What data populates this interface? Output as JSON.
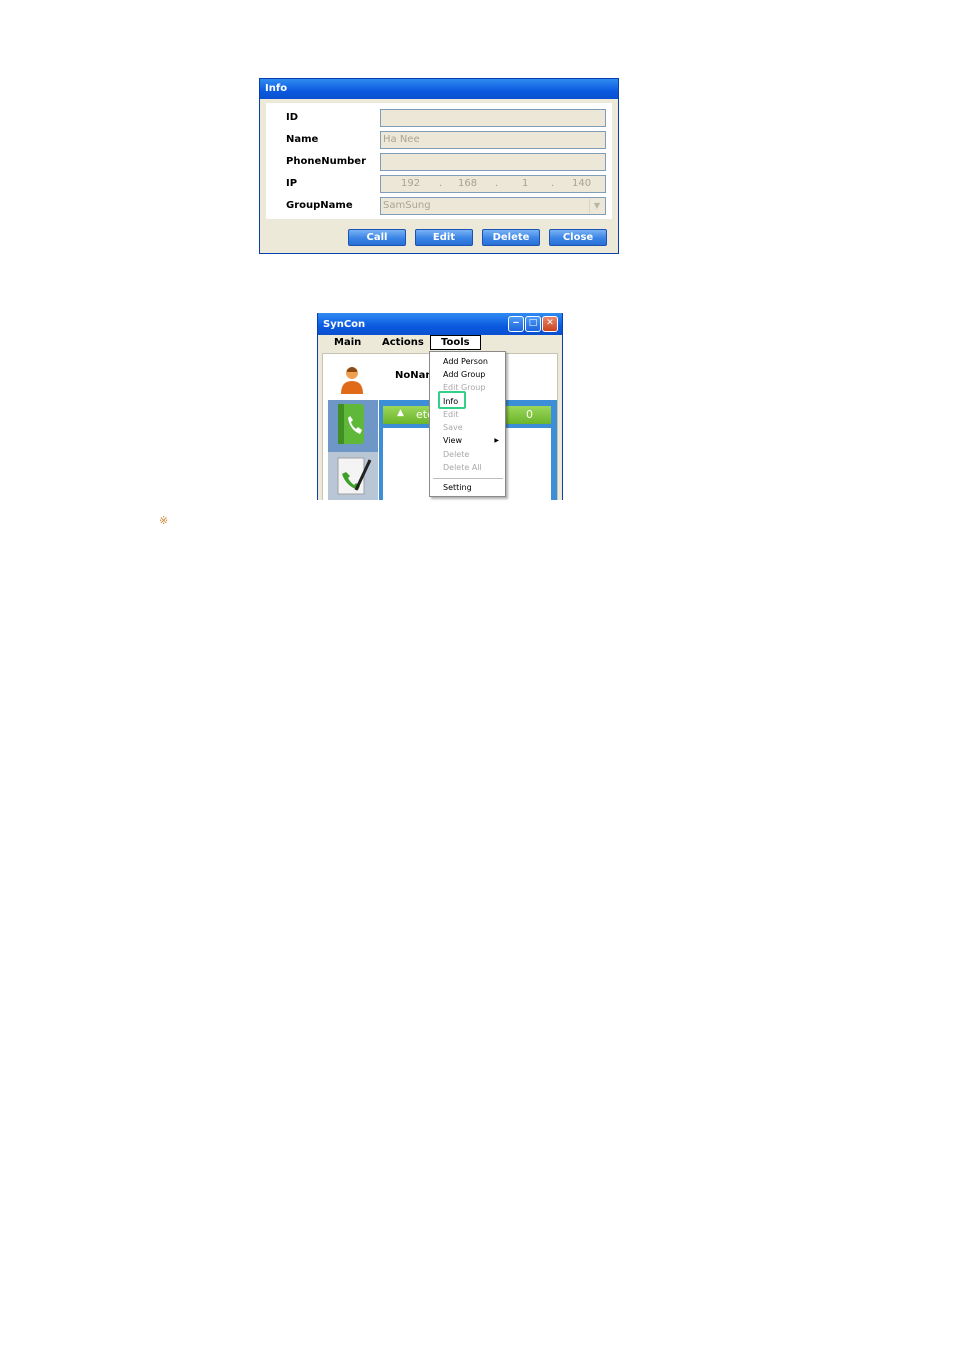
{
  "info_dialog": {
    "title": "Info",
    "fields": [
      {
        "label": "ID",
        "value": ""
      },
      {
        "label": "Name",
        "value": "Ha Nee"
      },
      {
        "label": "PhoneNumber",
        "value": ""
      },
      {
        "label": "IP",
        "value": ""
      },
      {
        "label": "GroupName",
        "value": "SamSung"
      }
    ],
    "ip_parts": [
      "192",
      ".",
      "168",
      ".",
      "1",
      ".",
      "140"
    ],
    "buttons": {
      "call": "Call",
      "edit": "Edit",
      "delete": "Delete",
      "close": "Close"
    }
  },
  "syncon": {
    "title": "SynCon",
    "menu": {
      "main": "Main",
      "actions": "Actions",
      "tools": "Tools"
    },
    "user_name": "NoName",
    "group": {
      "name": "etc",
      "count": "0"
    },
    "tools_menu": [
      {
        "label": "Add Person",
        "enabled": true
      },
      {
        "label": "Add Group",
        "enabled": true
      },
      {
        "label": "Edit Group",
        "enabled": false
      },
      {
        "label": "Info",
        "enabled": true
      },
      {
        "label": "Edit",
        "enabled": false
      },
      {
        "label": "Save",
        "enabled": false
      },
      {
        "label": "View",
        "enabled": true,
        "submenu": true
      },
      {
        "label": "Delete",
        "enabled": false
      },
      {
        "label": "Delete All",
        "enabled": false
      },
      {
        "label": "Setting",
        "enabled": true
      }
    ],
    "colors": {
      "titlebar": "#0b5ae0",
      "group_header": "#6bb52a",
      "highlight": "#33d08a"
    }
  },
  "note_symbol": "※"
}
